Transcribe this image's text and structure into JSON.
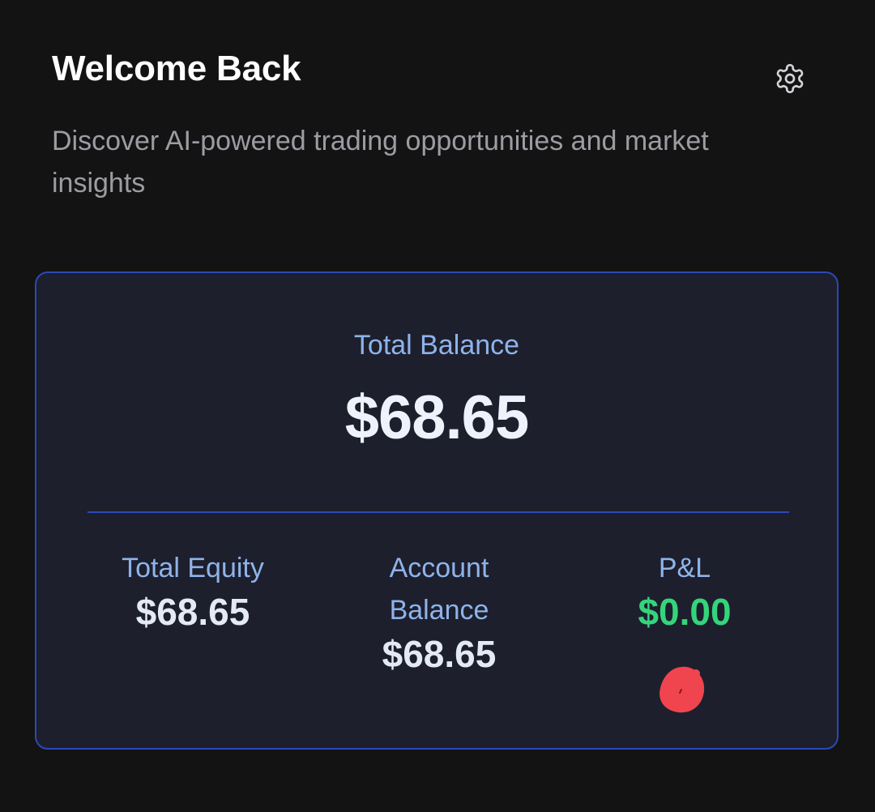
{
  "header": {
    "title": "Welcome Back",
    "subtitle": "Discover AI-powered trading opportunities and market insights",
    "settings_icon": "gear-icon"
  },
  "balance_card": {
    "total_label": "Total Balance",
    "total_value": "$68.65",
    "stats": [
      {
        "label": "Total Equity",
        "value": "$68.65"
      },
      {
        "label": "Account Balance",
        "value": "$68.65"
      },
      {
        "label": "P&L",
        "value": "$0.00"
      }
    ]
  },
  "colors": {
    "background": "#131314",
    "card_background": "#1d1f2d",
    "card_border": "#2c49b8",
    "label_blue": "#8fb3ea",
    "pnl_green": "#35d47b",
    "annotation_red": "#f0454e"
  }
}
